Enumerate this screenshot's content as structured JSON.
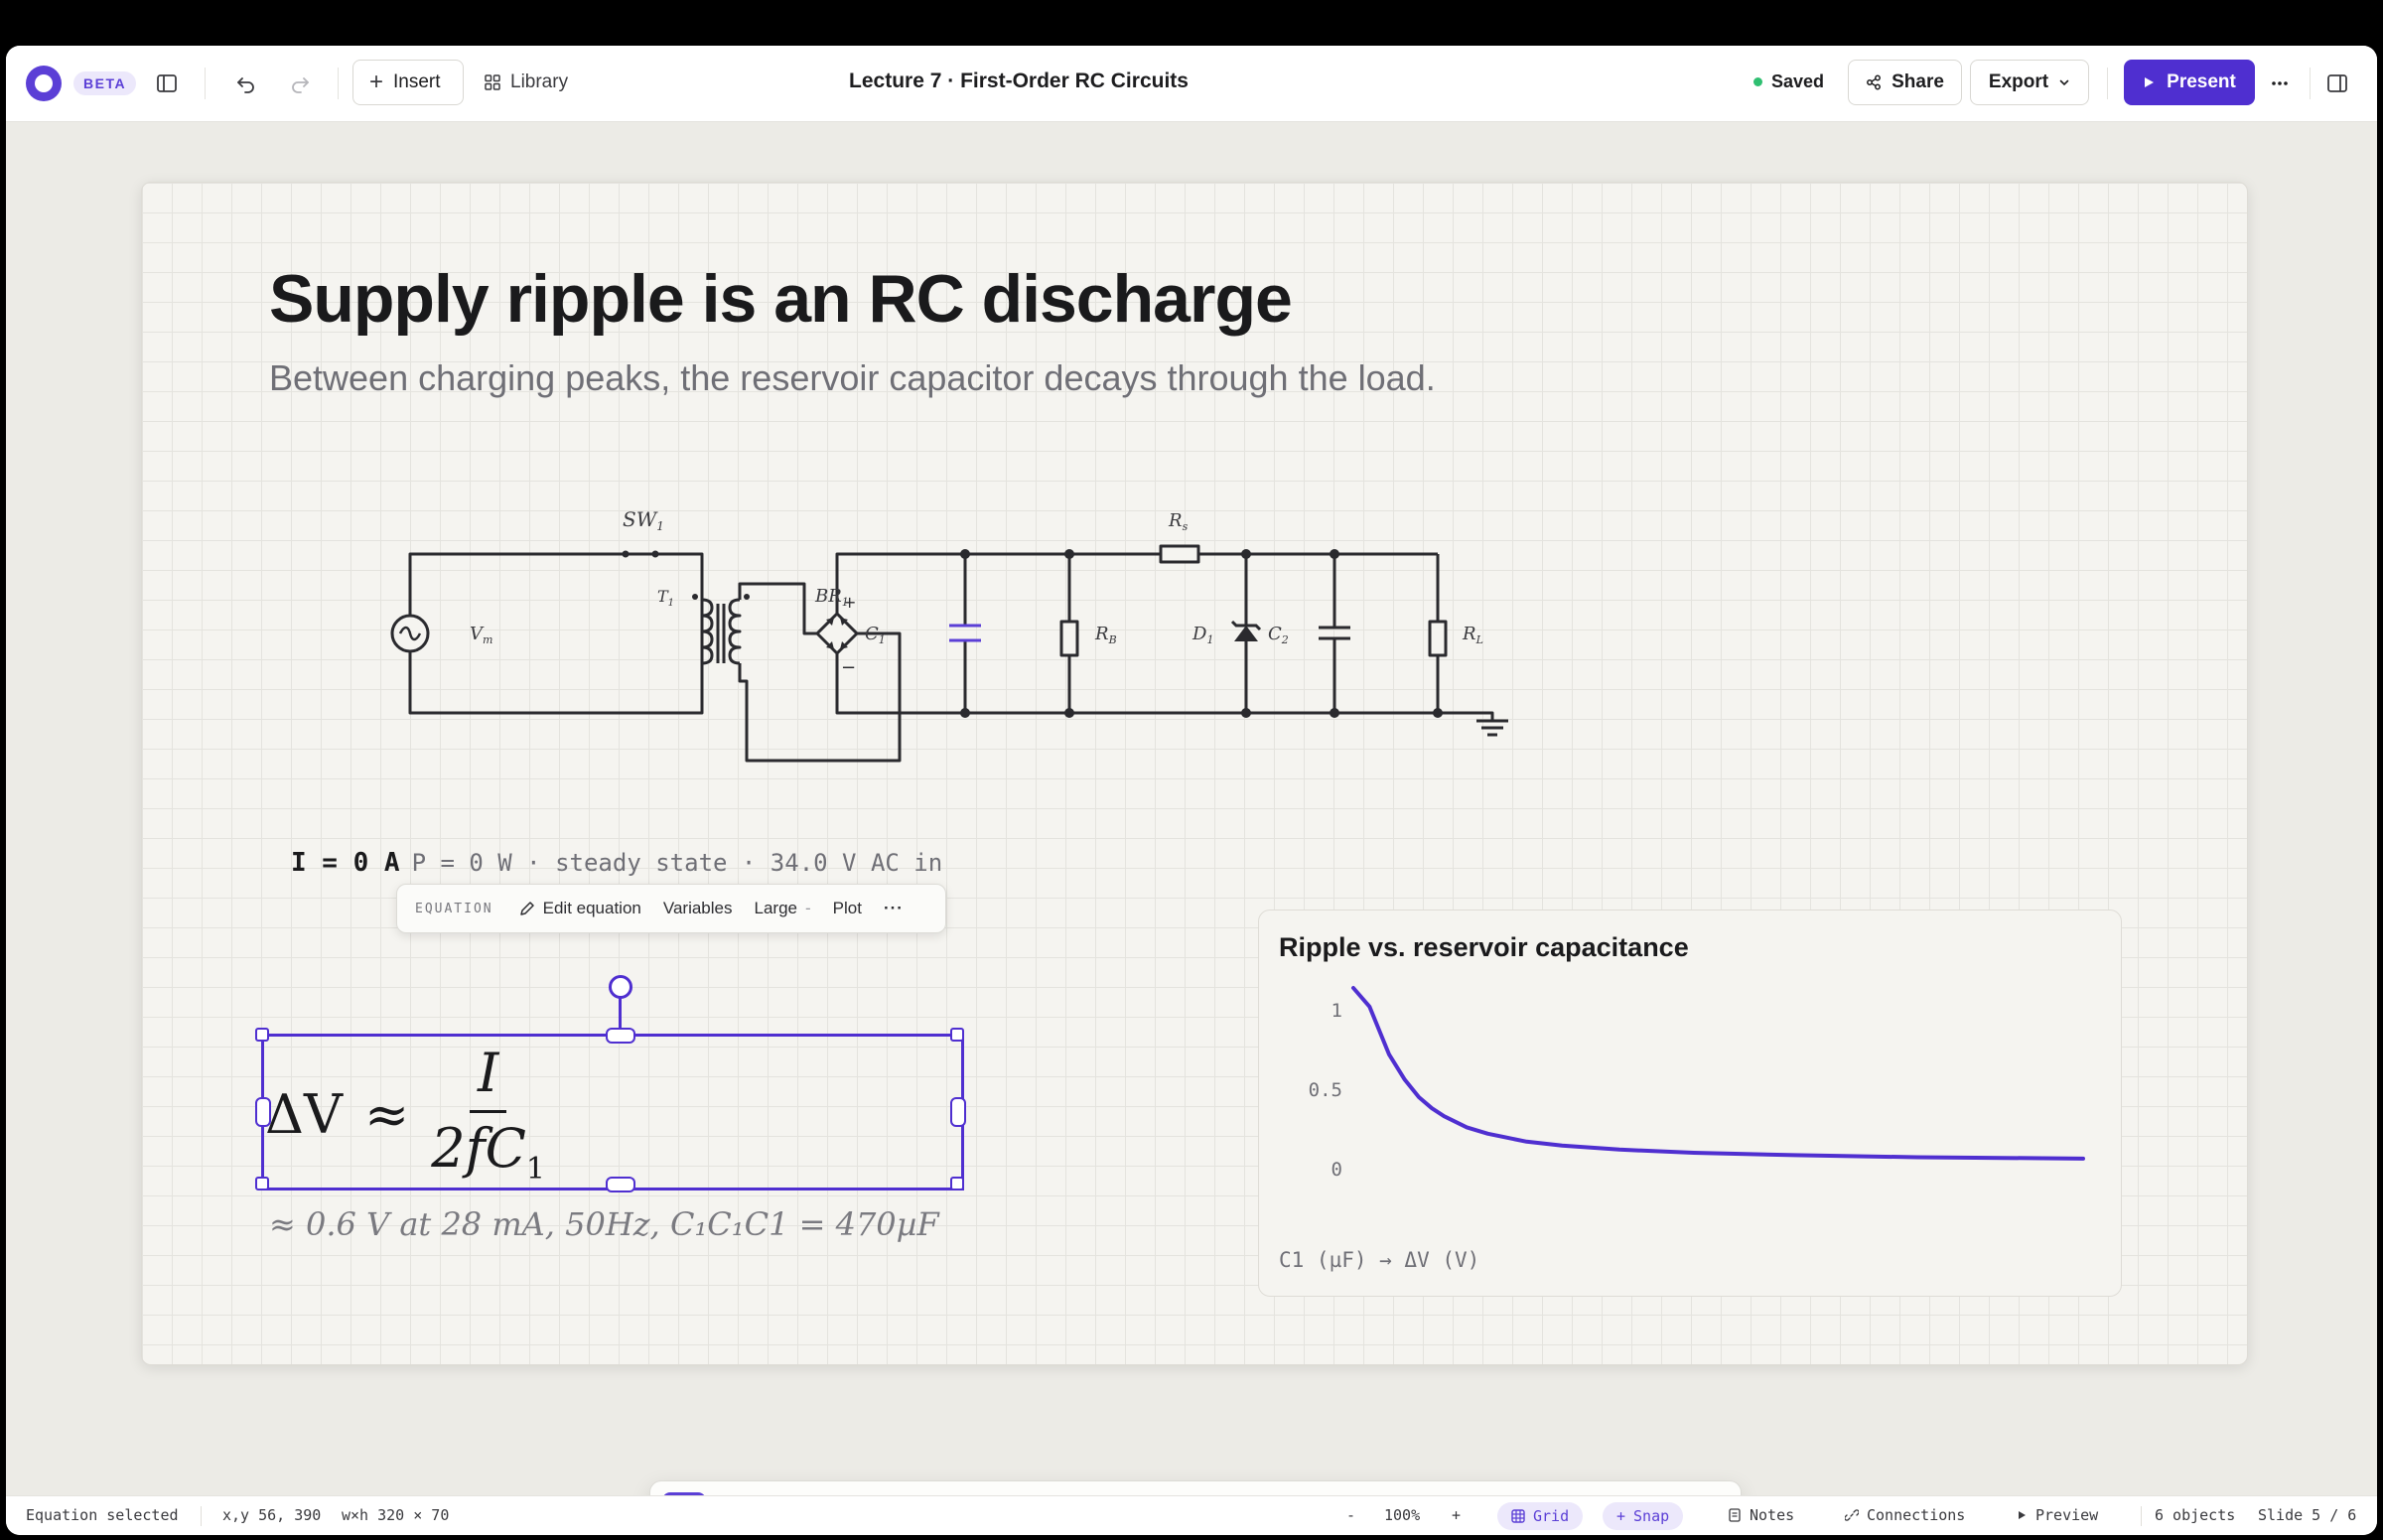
{
  "app": {
    "beta_badge": "BETA",
    "insert_label": "Insert",
    "library_label": "Library",
    "document_title": "Lecture 7 · First-Order RC Circuits",
    "saved_label": "Saved",
    "share_label": "Share",
    "export_label": "Export",
    "present_label": "Present",
    "accent_color": "#4f2fd0"
  },
  "slide": {
    "title": "Supply ripple is an RC discharge",
    "subtitle": "Between charging peaks, the reservoir capacitor decays through the load.",
    "circuit_labels": {
      "switch": "SW",
      "switch_sub": "1",
      "source": "V",
      "source_sub": "m",
      "transformer": "T",
      "transformer_sub": "1",
      "bridge": "BR",
      "bridge_sub": "1",
      "c1": "C",
      "c1_sub": "1",
      "rs": "R",
      "rs_sub": "s",
      "rb": "R",
      "rb_sub": "B",
      "d1": "D",
      "d1_sub": "1",
      "c2": "C",
      "c2_sub": "2",
      "rl": "R",
      "rl_sub": "L"
    },
    "status_current": "I = 0 A",
    "status_rest": "P = 0 W · steady state · 34.0 V AC in",
    "equation_toolbar": {
      "tag": "EQUATION",
      "edit": "Edit equation",
      "variables": "Variables",
      "size": "Large",
      "plot": "Plot"
    },
    "equation": {
      "lhs": "ΔV",
      "rel": "≈",
      "numerator": "I",
      "denominator": "2fC",
      "denominator_sub": "1"
    },
    "equation_approx": "≈ 0.6 V at 28 mA, 50Hz, C₁C₁C1 = 470µF",
    "chart_caption": "C1 (µF) → ΔV (V)"
  },
  "chart_data": {
    "type": "line",
    "title": "Ripple vs. reservoir capacitance",
    "xlabel": "C1 (µF)",
    "ylabel": "ΔV (V)",
    "ytick_labels": [
      "1",
      "0.5",
      "0"
    ],
    "ylim": [
      0,
      1
    ],
    "grid": false,
    "legend": "none",
    "series": [
      {
        "x": [
          0.5,
          1,
          2,
          3,
          4,
          5,
          6,
          8,
          10,
          14,
          18,
          25,
          35,
          50,
          70,
          90,
          100
        ],
        "values": [
          1.28,
          1.02,
          0.72,
          0.56,
          0.45,
          0.38,
          0.33,
          0.26,
          0.22,
          0.17,
          0.145,
          0.12,
          0.1,
          0.085,
          0.072,
          0.066,
          0.063
        ],
        "color": "#4f2fd0"
      }
    ]
  },
  "dock": {
    "tools": [
      "select-tool",
      "hand-tool",
      "text-tool",
      "shape-tool",
      "equation-tool",
      "code-tool",
      "connector-tool",
      "simulation-tool",
      "chart-tool",
      "table-tool",
      "widget-tool",
      "3d-tool",
      "image-tool",
      "play-tool",
      "ai-tool",
      "comment-tool"
    ]
  },
  "statusbar": {
    "selection": "Equation selected",
    "xy": "x,y 56, 390",
    "wh": "w×h 320 × 70",
    "zoom_minus": "-",
    "zoom": "100%",
    "zoom_plus": "+",
    "grid": "Grid",
    "snap": "Snap",
    "notes": "Notes",
    "connections": "Connections",
    "preview": "Preview",
    "objects": "6 objects",
    "slide": "Slide 5 / 6"
  }
}
